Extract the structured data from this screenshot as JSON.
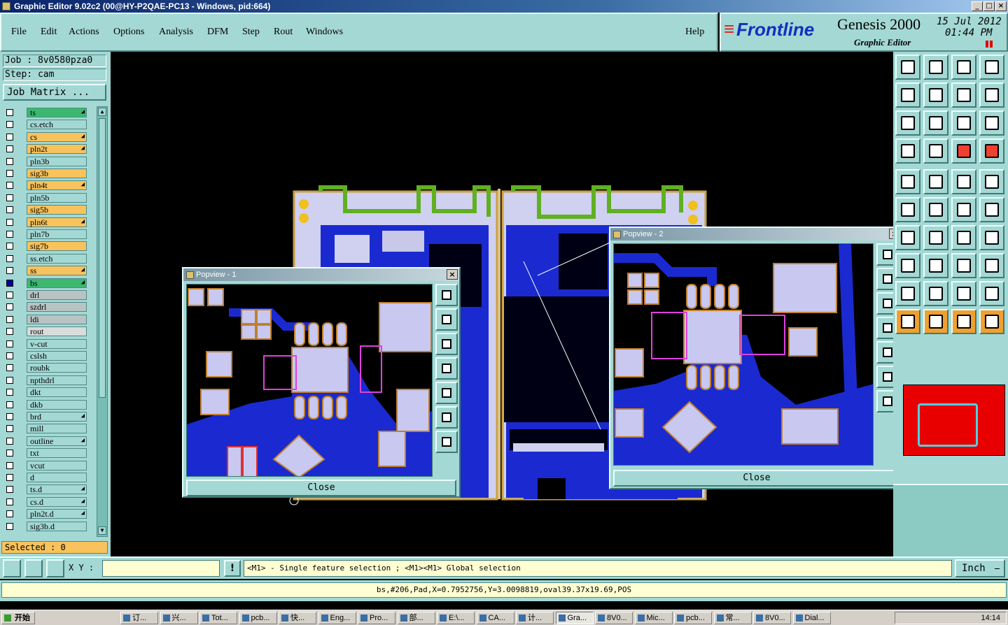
{
  "window": {
    "title": "Graphic Editor 9.02c2 (00@HY-P2QAE-PC13 - Windows, pid:664)"
  },
  "menu": {
    "items": [
      "File",
      "Edit",
      "Actions",
      "Options",
      "Analysis",
      "DFM",
      "Step",
      "Rout",
      "Windows"
    ],
    "help": "Help"
  },
  "brand": {
    "logo": "Frontline",
    "product": "Genesis 2000",
    "subtitle": "Graphic Editor",
    "date": "15 Jul 2012",
    "time": "01:44 PM"
  },
  "job": {
    "job_line": "Job : 8v0580pza0",
    "step_line": "Step: cam",
    "matrix_button": "Job Matrix ..."
  },
  "layers": [
    {
      "name": "ts",
      "color": "#3cb870",
      "mark": "◢"
    },
    {
      "name": "cs.etch",
      "color": "#a4d8d4",
      "mark": ""
    },
    {
      "name": "cs",
      "color": "#f8c25c",
      "mark": "◢"
    },
    {
      "name": "pln2t",
      "color": "#f8c25c",
      "mark": "◢"
    },
    {
      "name": "pln3b",
      "color": "#a4d8d4",
      "mark": ""
    },
    {
      "name": "sig3b",
      "color": "#f8c25c",
      "mark": ""
    },
    {
      "name": "pln4t",
      "color": "#f8c25c",
      "mark": "◢"
    },
    {
      "name": "pln5b",
      "color": "#a4d8d4",
      "mark": ""
    },
    {
      "name": "sig5b",
      "color": "#f8c25c",
      "mark": ""
    },
    {
      "name": "pln6t",
      "color": "#f8c25c",
      "mark": "◢"
    },
    {
      "name": "pln7b",
      "color": "#a4d8d4",
      "mark": ""
    },
    {
      "name": "sig7b",
      "color": "#f8c25c",
      "mark": ""
    },
    {
      "name": "ss.etch",
      "color": "#a4d8d4",
      "mark": ""
    },
    {
      "name": "ss",
      "color": "#f8c25c",
      "mark": "◢"
    },
    {
      "name": "bs",
      "color": "#3cb870",
      "mark": "◢"
    },
    {
      "name": "drl",
      "color": "#b8c4c4",
      "mark": ""
    },
    {
      "name": "szdrl",
      "color": "#b8c4c4",
      "mark": ""
    },
    {
      "name": "ldi",
      "color": "#b8c4c4",
      "mark": ""
    },
    {
      "name": "rout",
      "color": "#d8dcdc",
      "mark": ""
    },
    {
      "name": "v-cut",
      "color": "#a4d8d4",
      "mark": ""
    },
    {
      "name": "cslsh",
      "color": "#a4d8d4",
      "mark": ""
    },
    {
      "name": "roubk",
      "color": "#a4d8d4",
      "mark": ""
    },
    {
      "name": "npthdrl",
      "color": "#a4d8d4",
      "mark": ""
    },
    {
      "name": "dkt",
      "color": "#a4d8d4",
      "mark": ""
    },
    {
      "name": "dkb",
      "color": "#a4d8d4",
      "mark": ""
    },
    {
      "name": "brd",
      "color": "#a4d8d4",
      "mark": "◢"
    },
    {
      "name": "mill",
      "color": "#a4d8d4",
      "mark": ""
    },
    {
      "name": "outline",
      "color": "#a4d8d4",
      "mark": "◢"
    },
    {
      "name": "txt",
      "color": "#a4d8d4",
      "mark": ""
    },
    {
      "name": "vcut",
      "color": "#a4d8d4",
      "mark": ""
    },
    {
      "name": "d",
      "color": "#a4d8d4",
      "mark": ""
    },
    {
      "name": "ts.d",
      "color": "#a4d8d4",
      "mark": "◢"
    },
    {
      "name": "cs.d",
      "color": "#a4d8d4",
      "mark": "◢"
    },
    {
      "name": "pln2t.d",
      "color": "#a4d8d4",
      "mark": "◢"
    },
    {
      "name": "sig3b.d",
      "color": "#a4d8d4",
      "mark": ""
    }
  ],
  "selected_text": "Selected : 0",
  "popup1": {
    "title": "Popview - 1",
    "close": "Close"
  },
  "popup2": {
    "title": "Popview - 2",
    "close": "Close"
  },
  "command": {
    "xy_label": "X Y :",
    "xy_value": "",
    "prompt": "<M1> - Single feature selection ; <M1><M1> Global selection",
    "units": "Inch"
  },
  "status": "bs,#206,Pad,X=0.7952756,Y=3.0098819,oval39.37x19.69,POS",
  "taskbar": {
    "start": "开始",
    "items": [
      "订...",
      "兴...",
      "Tot...",
      "pcb...",
      "快...",
      "Eng...",
      "Pro...",
      "部...",
      "E:\\...",
      "CA...",
      "计...",
      "Gra...",
      "8V0...",
      "Mic...",
      "pcb...",
      "常...",
      "8V0...",
      "Dial..."
    ],
    "clock": "14:14"
  }
}
